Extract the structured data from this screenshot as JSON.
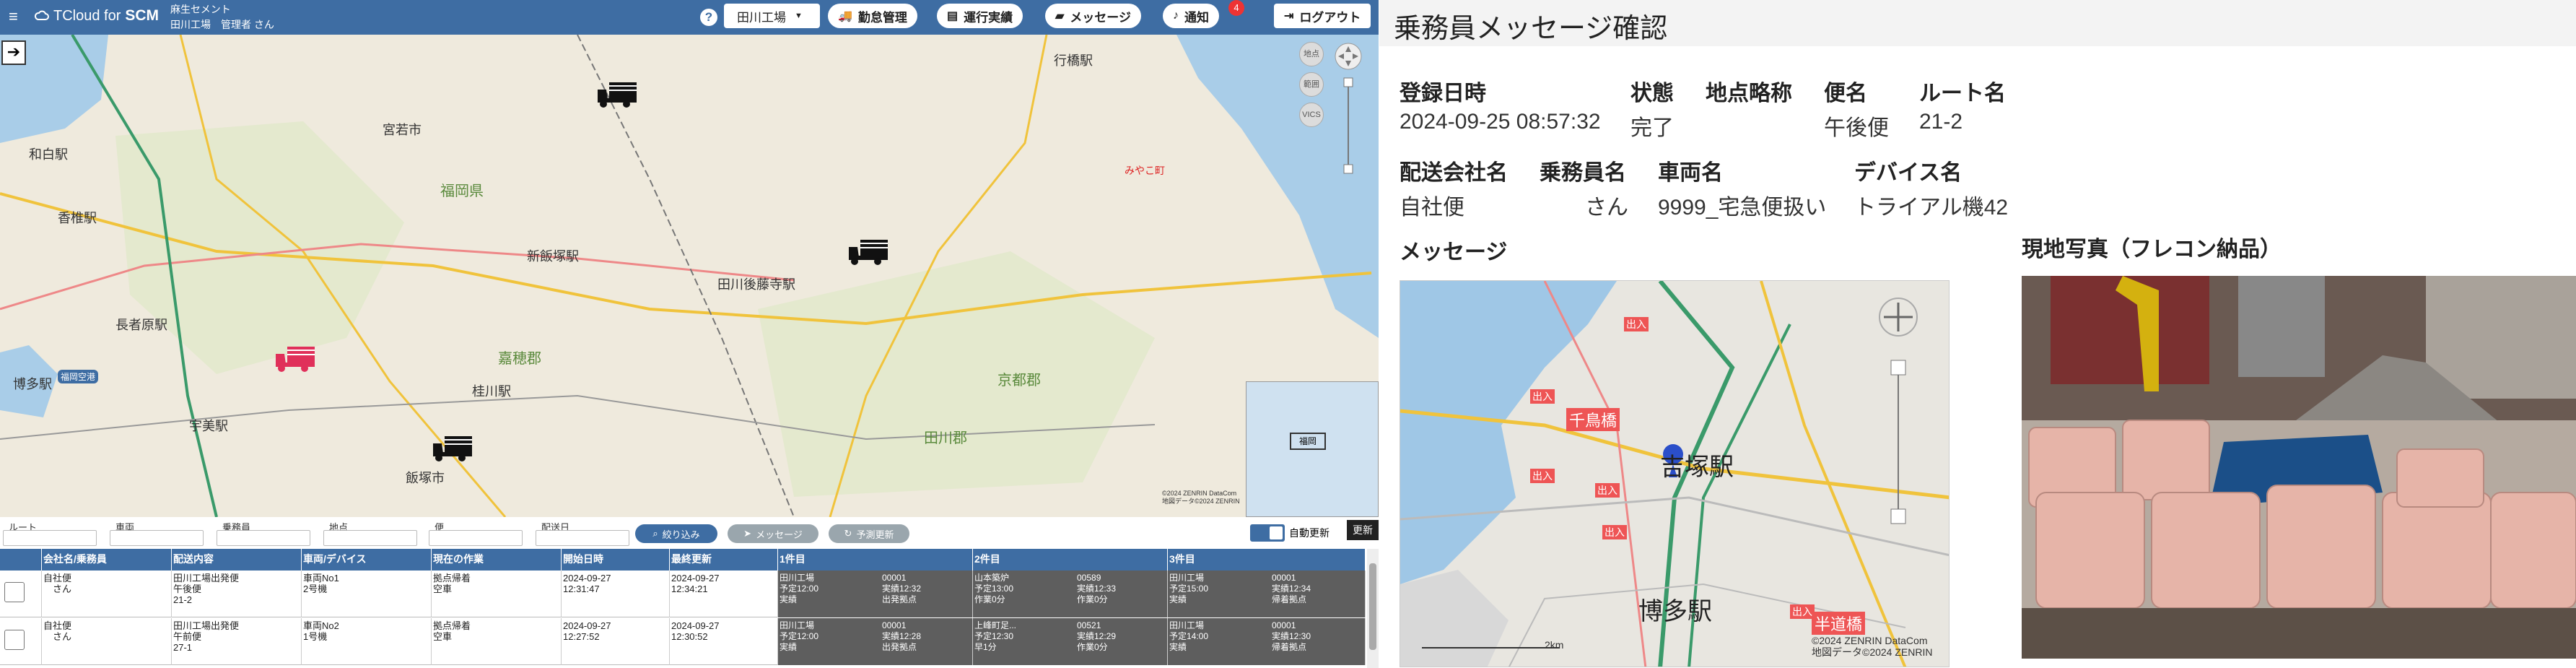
{
  "header": {
    "app_name_prefix": "TCloud for",
    "app_name_bold": "SCM",
    "company_name": "麻生セメント",
    "user_info": "田川工場　管理者 さん",
    "help_label": "?",
    "plant_selector": "田川工場",
    "buttons": {
      "attendance": "勤怠管理",
      "operation": "運行実績",
      "message": "メッセージ",
      "notification": "通知",
      "logout": "ログアウト"
    },
    "notification_count": "4"
  },
  "map": {
    "place_labels": [
      "行橋駅",
      "宮若市",
      "和白駅",
      "香椎駅",
      "福岡県",
      "新飯塚駅",
      "田川後藤寺駅",
      "長者原駅",
      "嘉穂郡",
      "京都郡",
      "博多駅",
      "宇美駅",
      "飯塚市",
      "桂川駅",
      "田川郡",
      "福岡空港",
      "みやこ町"
    ],
    "controls": [
      "地点",
      "範囲",
      "VICS"
    ],
    "copyright": "©2024 ZENRIN DataCom\n地図データ©2024 ZENRIN",
    "minimap_label": "福岡"
  },
  "filter": {
    "route_label": "ルート",
    "vehicle_label": "車両",
    "crew_label": "乗務員",
    "point_label": "地点",
    "flight_label": "便",
    "delivery_date_label": "配送日",
    "narrow_button": "絞り込み",
    "message_button": "メッセージ",
    "forecast_button": "予測更新",
    "auto_update_label": "自動更新",
    "refresh_button": "更新"
  },
  "table": {
    "columns": [
      "会社名/乗務員",
      "配送内容",
      "車両/デバイス",
      "現在の作業",
      "開始日時",
      "最終更新",
      "1件目",
      "2件目",
      "3件目"
    ],
    "rows": [
      {
        "company": "自社便\n　さん",
        "delivery": "田川工場出発便\n午後便\n21-2",
        "vehicle": "車両No1\n2号機",
        "current_work": "拠点帰着\n空車",
        "start": "2024-09-27\n12:31:47",
        "updated": "2024-09-27\n12:34:21",
        "stops": [
          {
            "name": "田川工場\n予定12:00\n実績",
            "code": "00001\n実績12:32\n出発拠点"
          },
          {
            "name": "山本築炉\n予定13:00\n作業0分",
            "code": "00589\n実績12:33\n作業0分"
          },
          {
            "name": "田川工場\n予定15:00\n実績",
            "code": "00001\n実績12:34\n帰着拠点"
          }
        ]
      },
      {
        "company": "自社便\n　さん",
        "delivery": "田川工場出発便\n午前便\n27-1",
        "vehicle": "車両No2\n1号機",
        "current_work": "拠点帰着\n空車",
        "start": "2024-09-27\n12:27:52",
        "updated": "2024-09-27\n12:30:52",
        "stops": [
          {
            "name": "田川工場\n予定12:00\n実績",
            "code": "00001\n実績12:28\n出発拠点"
          },
          {
            "name": "上峰町足...\n予定12:30\n早1分",
            "code": "00521\n実績12:29\n作業0分"
          },
          {
            "name": "田川工場\n予定14:00\n実績",
            "code": "00001\n実績12:30\n帰着拠点"
          }
        ]
      }
    ]
  },
  "detail": {
    "title": "乗務員メッセージ確認",
    "labels": {
      "registered": "登録日時",
      "status": "状態",
      "point_abbr": "地点略称",
      "flight_name": "便名",
      "route_name": "ルート名",
      "company": "配送会社名",
      "crew": "乗務員名",
      "vehicle": "車両名",
      "device": "デバイス名",
      "message": "メッセージ",
      "photo": "現地写真（フレコン納品）"
    },
    "values": {
      "registered": "2024-09-25 08:57:32",
      "status": "完了",
      "point_abbr": "",
      "flight_name": "午後便",
      "route_name": "21-2",
      "company": "自社便",
      "crew": "さん",
      "vehicle": "9999_宅急便扱い",
      "device": "トライアル機42"
    },
    "message_map": {
      "labels": [
        "吉塚駅",
        "博多駅",
        "千鳥橋",
        "半道橋",
        "出入",
        "出入",
        "出入",
        "出入",
        "出入",
        "出入"
      ],
      "scale": "2km",
      "copyright": "©2024 ZENRIN DataCom\n地図データ©2024 ZENRIN"
    }
  }
}
